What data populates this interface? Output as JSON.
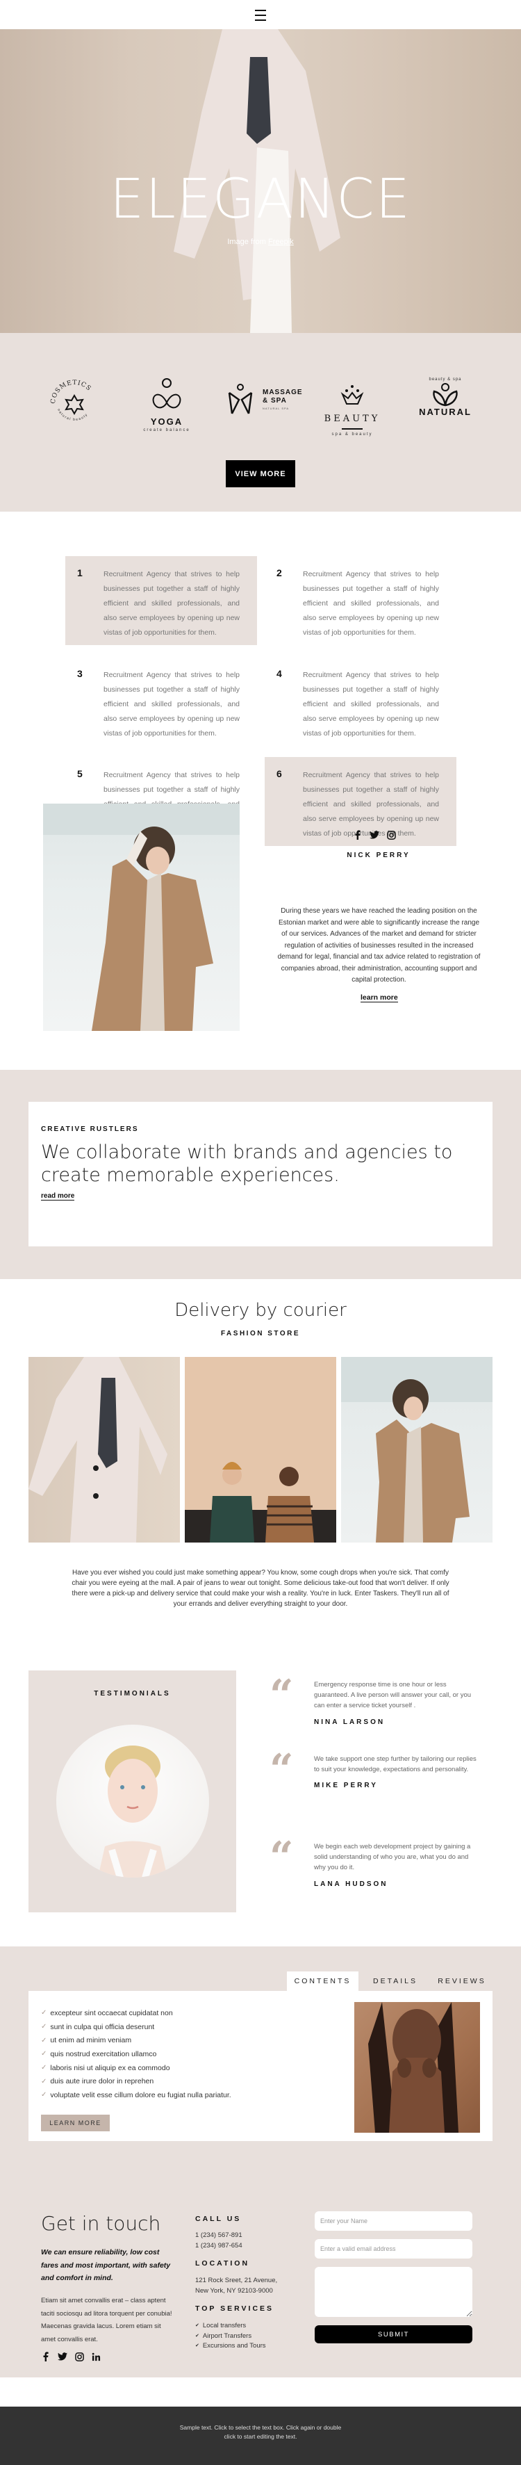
{
  "header": {
    "menu_icon": "hamburger-menu-icon"
  },
  "hero": {
    "title": "ELEGANCE",
    "credit_prefix": "Image from ",
    "credit_link": "Freepik"
  },
  "logos": {
    "items": [
      {
        "name": "COSMETICS",
        "sub": "natural beauty",
        "icon": "flower-icon"
      },
      {
        "name": "YOGA",
        "sub": "create balance",
        "icon": "yoga-figure-icon"
      },
      {
        "name": "MASSAGE & SPA",
        "sub": "NATURAL SPA",
        "icon": "spa-figure-icon"
      },
      {
        "name": "BEAUTY",
        "sub": "spa & beauty",
        "icon": "lotus-icon"
      },
      {
        "name": "NATURAL",
        "sub": "beauty & spa",
        "icon": "leaf-figure-icon"
      }
    ],
    "view_more": "VIEW MORE"
  },
  "features": {
    "items": [
      {
        "num": "1",
        "text": "Recruitment Agency that strives to help businesses put together a staff of highly efficient and skilled professionals, and also serve employees by opening up new vistas of job opportunities for them.",
        "highlighted": true
      },
      {
        "num": "2",
        "text": "Recruitment Agency that strives to help businesses put together a staff of highly efficient and skilled professionals, and also serve employees by opening up new vistas of job opportunities for them.",
        "highlighted": false
      },
      {
        "num": "3",
        "text": "Recruitment Agency that strives to help businesses put together a staff of highly efficient and skilled professionals, and also serve employees by opening up new vistas of job opportunities for them.",
        "highlighted": false
      },
      {
        "num": "4",
        "text": "Recruitment Agency that strives to help businesses put together a staff of highly efficient and skilled professionals, and also serve employees by opening up new vistas of job opportunities for them.",
        "highlighted": false
      },
      {
        "num": "5",
        "text": "Recruitment Agency that strives to help businesses put together a staff of highly efficient and skilled professionals, and also serve employees by opening up new vistas of job opportunities for them.",
        "highlighted": false
      },
      {
        "num": "6",
        "text": "Recruitment Agency that strives to help businesses put together a staff of highly efficient and skilled professionals, and also serve employees by opening up new vistas of job opportunities for them.",
        "highlighted": true
      }
    ]
  },
  "profile": {
    "social": [
      "facebook-icon",
      "twitter-icon",
      "instagram-icon"
    ],
    "name": "NICK PERRY",
    "description": "During these years we have reached the leading position on the Estonian market and were able to significantly increase the range of our services. Advances of the market and demand for stricter regulation of activities of businesses resulted in the increased demand for legal, financial and tax advice related to registration of companies abroad, their administration, accounting support and capital protection.",
    "link": "learn more"
  },
  "creative": {
    "label": "CREATIVE RUSTLERS",
    "headline": "We collaborate with brands and agencies to create memorable experiences.",
    "link": "read more"
  },
  "delivery": {
    "title": "Delivery by courier",
    "subtitle": "FASHION STORE",
    "text": "Have you ever wished you could just make something appear? You know, some cough drops when you're sick. That comfy chair you were eyeing at the mall. A pair of jeans to wear out tonight. Some delicious take-out food that won't deliver. If only there were a pick-up and delivery service that could make your wish a reality. You're in luck. Enter Taskers. They'll run all of your errands and deliver everything straight to your door."
  },
  "testimonials": {
    "label": "TESTIMONIALS",
    "items": [
      {
        "text": "Emergency response time is one hour or less guaranteed. A live person will answer your call, or you can enter a service ticket yourself .",
        "name": "NINA LARSON"
      },
      {
        "text": "We take support one step further by tailoring our replies to suit your knowledge, expectations and personality.",
        "name": "MIKE PERRY"
      },
      {
        "text": "We begin each web development project by gaining a solid understanding of who you are, what you do and why you do it.",
        "name": "LANA HUDSON"
      }
    ]
  },
  "tabs": {
    "items": [
      {
        "label": "CONTENTS",
        "active": true
      },
      {
        "label": "DETAILS",
        "active": false
      },
      {
        "label": "REVIEWS",
        "active": false
      }
    ],
    "checklist": [
      "excepteur sint occaecat cupidatat non",
      "sunt in culpa qui officia deserunt",
      "ut enim ad minim veniam",
      "quis nostrud exercitation ullamco",
      "laboris nisi ut aliquip ex ea commodo",
      "duis aute irure dolor in reprehen",
      "voluptate velit esse cillum dolore eu fugiat nulla pariatur."
    ],
    "button": "LEARN MORE"
  },
  "contact": {
    "title": "Get in touch",
    "lead": "We can ensure reliability, low cost fares and most important, with safety and comfort in mind.",
    "body": "Etiam sit amet convallis erat – class aptent taciti sociosqu ad litora torquent per conubia! Maecenas gravida lacus. Lorem etiam sit amet convallis erat.",
    "social": [
      "facebook-icon",
      "twitter-icon",
      "instagram-icon",
      "linkedin-icon"
    ],
    "call_heading": "CALL US",
    "phones": [
      "1 (234) 567-891",
      "1 (234) 987-654"
    ],
    "location_heading": "LOCATION",
    "address": [
      "121 Rock Sreet, 21 Avenue,",
      "New York, NY 92103-9000"
    ],
    "services_heading": "TOP SERVICES",
    "services": [
      "Local transfers",
      "Airport Transfers",
      "Excursions and Tours"
    ],
    "form": {
      "name_placeholder": "Enter your Name",
      "email_placeholder": "Enter a valid email address",
      "message_placeholder": "",
      "submit": "SUBMIT"
    }
  },
  "footer": {
    "text": "Sample text. Click to select the text box. Click again or double click to start editing the text."
  },
  "colors": {
    "accent_beige": "#e8e0dc",
    "quote_mark": "#c5b5ab",
    "button_dark": "#000000",
    "footer_bg": "#333333"
  }
}
